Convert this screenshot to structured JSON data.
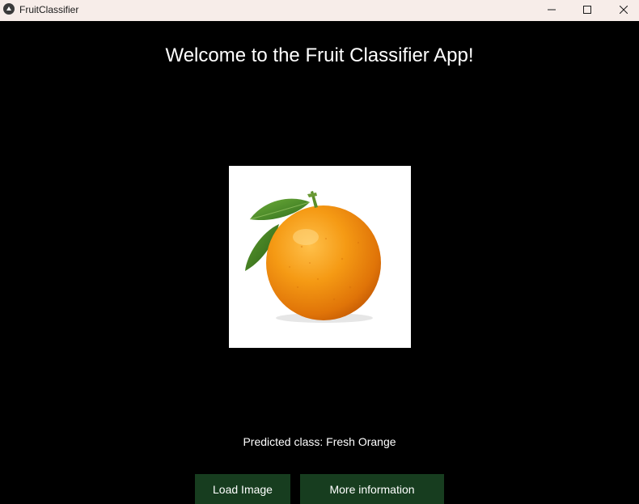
{
  "window": {
    "title": "FruitClassifier"
  },
  "main": {
    "heading": "Welcome to the Fruit Classifier App!",
    "image": {
      "subject": "orange-with-leaves"
    },
    "prediction_text": "Predicted class: Fresh Orange"
  },
  "buttons": {
    "load_image": "Load Image",
    "more_information": "More information"
  },
  "colors": {
    "background": "#000000",
    "titlebar": "#f7ede9",
    "button": "#173d1f",
    "text": "#ffffff"
  },
  "icons": {
    "app": "kivy-app-icon",
    "minimize": "minimize-icon",
    "maximize": "maximize-icon",
    "close": "close-icon"
  }
}
